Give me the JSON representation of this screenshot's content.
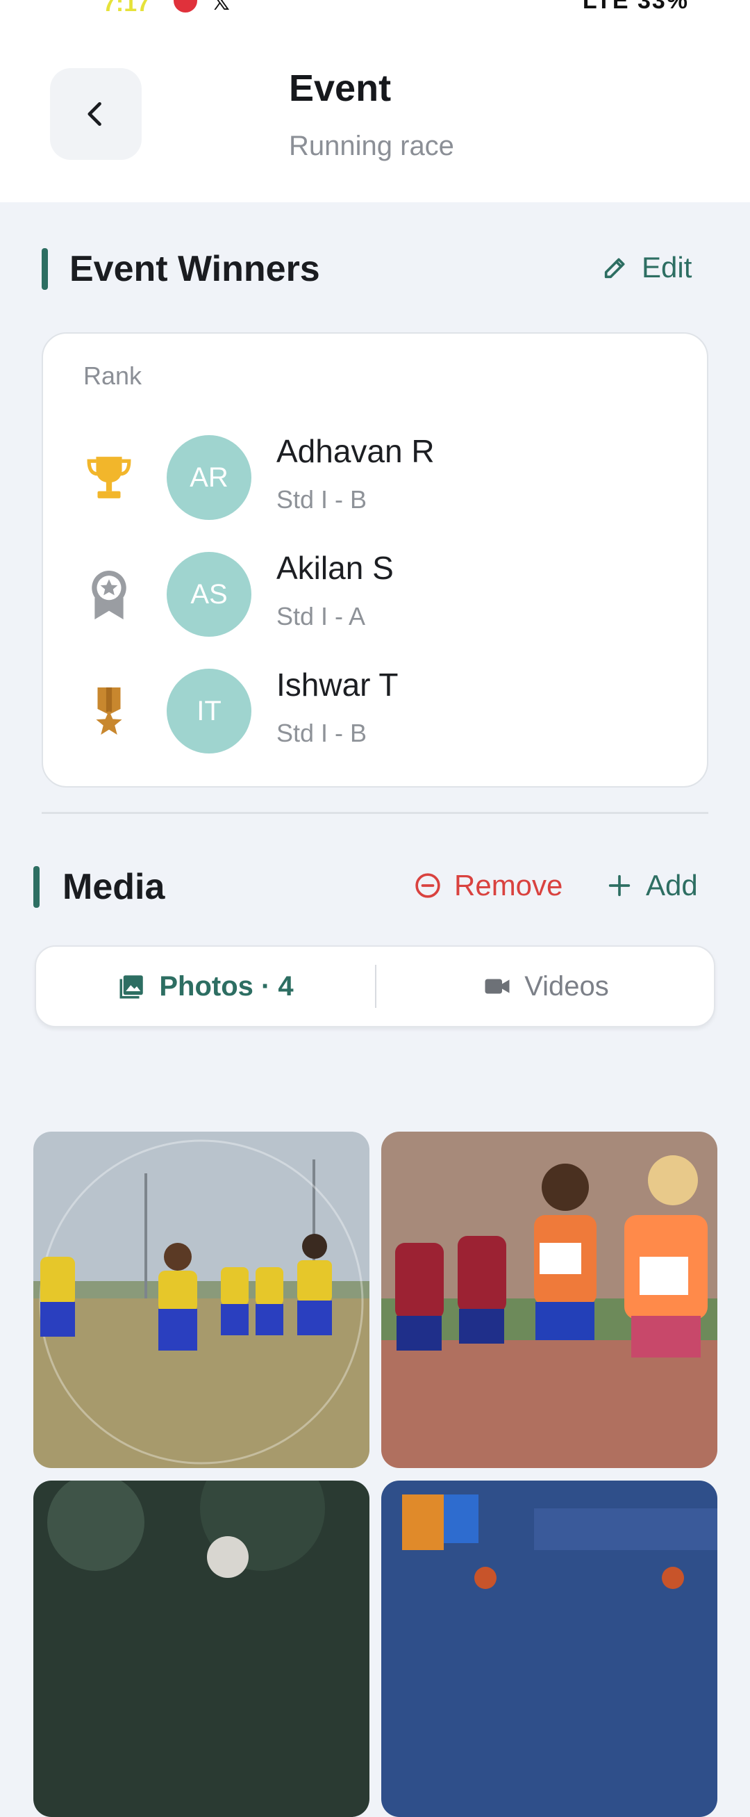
{
  "status_bar": {
    "time": "7:17",
    "right": "LTE 33%"
  },
  "header": {
    "title": "Event",
    "subtitle": "Running race"
  },
  "winners": {
    "title": "Event Winners",
    "edit_label": "Edit",
    "rank_label": "Rank",
    "items": [
      {
        "initials": "AR",
        "name": "Adhavan R",
        "class": "Std I - B",
        "medal": "trophy-icon",
        "medal_color": "#f2b62b"
      },
      {
        "initials": "AS",
        "name": "Akilan S",
        "class": "Std I - A",
        "medal": "silver-medal-icon",
        "medal_color": "#9a9da2"
      },
      {
        "initials": "IT",
        "name": "Ishwar T",
        "class": "Std I - B",
        "medal": "bronze-medal-icon",
        "medal_color": "#c8872e"
      }
    ]
  },
  "media": {
    "title": "Media",
    "remove_label": "Remove",
    "add_label": "Add",
    "tabs": {
      "photos": "Photos · 4",
      "videos": "Videos"
    },
    "photos": [
      {
        "alt": "Children in yellow and blue uniforms running on a field"
      },
      {
        "alt": "Children with race bibs running on a track"
      },
      {
        "alt": "Photo 3"
      },
      {
        "alt": "Photo 4"
      }
    ]
  },
  "colors": {
    "accent": "#2d6e62",
    "remove": "#d9423f",
    "avatar": "#9fd4cf",
    "background": "#f0f3f8"
  }
}
